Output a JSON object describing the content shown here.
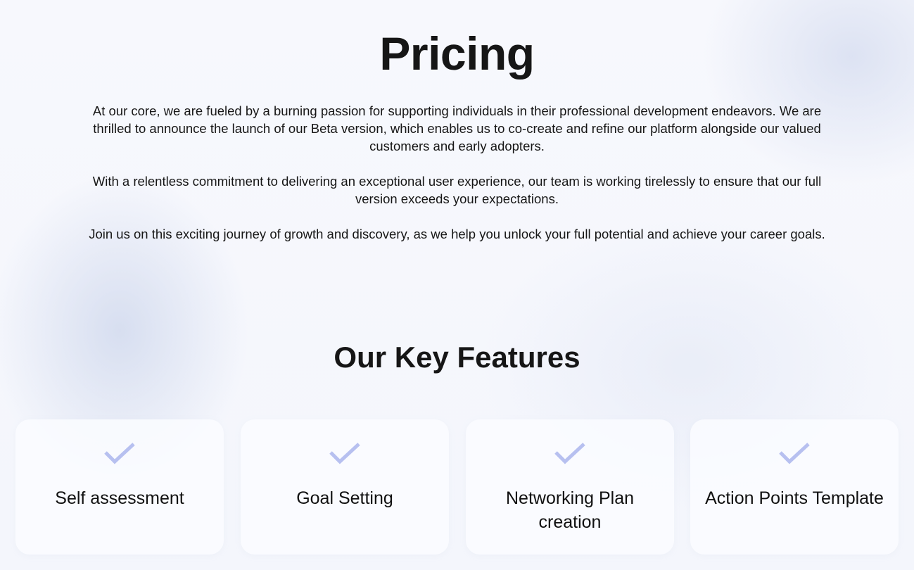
{
  "hero": {
    "title": "Pricing",
    "paragraphs": [
      "At our core, we are fueled by a burning passion for supporting individuals in their professional development endeavors. We are thrilled to announce the launch of our Beta version, which enables us to co-create and refine our platform alongside our valued customers and early adopters.",
      "With a relentless commitment to delivering an exceptional user experience, our team is working tirelessly to ensure that our full version exceeds your expectations.",
      "Join us on this exciting journey of growth and discovery, as we help you unlock your full potential and achieve your career goals."
    ]
  },
  "features": {
    "title": "Our Key Features",
    "check_color": "#b7c0f0",
    "items": [
      {
        "label": "Self assessment",
        "icon": "check-icon"
      },
      {
        "label": "Goal Setting",
        "icon": "check-icon"
      },
      {
        "label": "Networking Plan creation",
        "icon": "check-icon"
      },
      {
        "label": "Action Points Template",
        "icon": "check-icon"
      }
    ]
  }
}
